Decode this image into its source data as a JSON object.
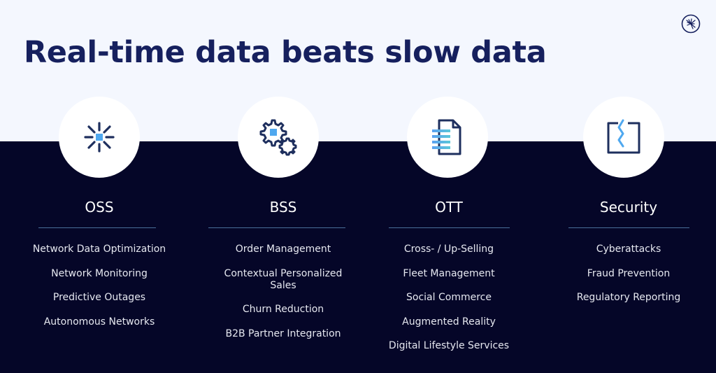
{
  "title": "Real-time data beats slow data",
  "logo_icon": "starburst-circle-logo-icon",
  "colors": {
    "title": "#16205e",
    "top_background": "#f4f7fe",
    "bottom_background": "#050628",
    "icon_stroke": "#1e2f5e",
    "icon_accent": "#4fa8ef",
    "divider": "#4a6f9a"
  },
  "columns": [
    {
      "heading": "OSS",
      "icon": "starburst-icon",
      "items": [
        "Network Data Optimization",
        "Network Monitoring",
        "Predictive Outages",
        "Autonomous Networks"
      ]
    },
    {
      "heading": "BSS",
      "icon": "gears-icon",
      "items": [
        "Order Management",
        "Contextual Personalized Sales",
        "Churn Reduction",
        "B2B Partner Integration"
      ]
    },
    {
      "heading": "OTT",
      "icon": "document-icon",
      "items": [
        "Cross- / Up-Selling",
        "Fleet Management",
        "Social Commerce",
        "Augmented Reality",
        "Digital Lifestyle Services"
      ]
    },
    {
      "heading": "Security",
      "icon": "broken-frame-icon",
      "items": [
        "Cyberattacks",
        "Fraud Prevention",
        "Regulatory Reporting"
      ]
    }
  ]
}
